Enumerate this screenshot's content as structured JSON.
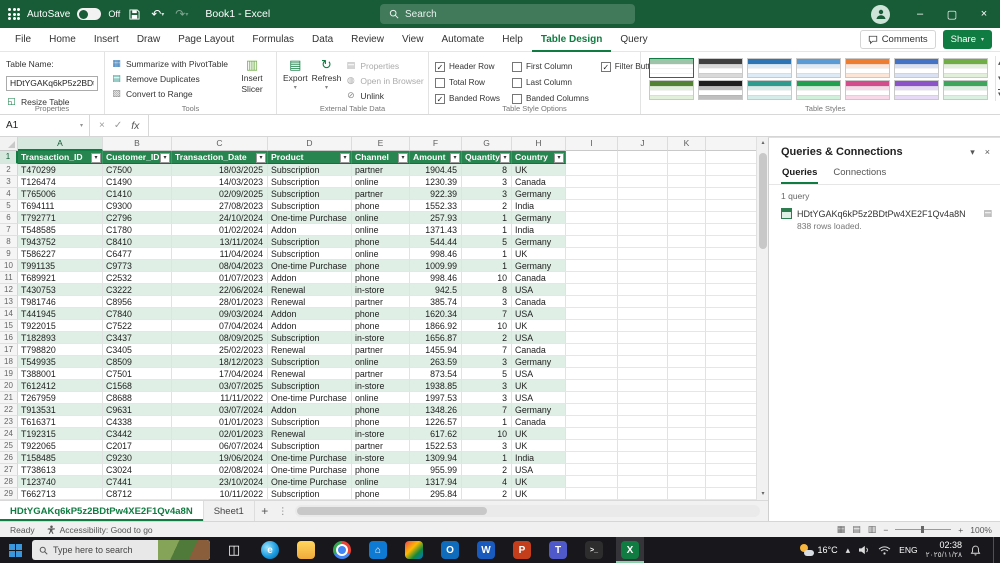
{
  "title_bar": {
    "autosave_label": "AutoSave",
    "autosave_state": "Off",
    "doc_title": "Book1 - Excel",
    "search_placeholder": "Search"
  },
  "ribbon": {
    "tabs": [
      "File",
      "Home",
      "Insert",
      "Draw",
      "Page Layout",
      "Formulas",
      "Data",
      "Review",
      "View",
      "Automate",
      "Help",
      "Table Design",
      "Query"
    ],
    "active_tab": "Table Design",
    "comments_label": "Comments",
    "share_label": "Share",
    "properties_group": {
      "group_label": "Properties",
      "table_name_label": "Table Name:",
      "table_name_value": "HDtYGAKq6kP5z2BDtPw4XE2F1Qv4a8N",
      "resize_table_label": "Resize Table"
    },
    "tools_group": {
      "group_label": "Tools",
      "summarize_label": "Summarize with PivotTable",
      "remove_duplicates_label": "Remove Duplicates",
      "convert_label": "Convert to Range",
      "insert_slicer_line1": "Insert",
      "insert_slicer_line2": "Slicer"
    },
    "external_group": {
      "group_label": "External Table Data",
      "export_label": "Export",
      "refresh_label": "Refresh",
      "properties_label": "Properties",
      "open_browser_label": "Open in Browser",
      "unlink_label": "Unlink"
    },
    "style_options": {
      "group_label": "Table Style Options",
      "options": [
        {
          "label": "Header Row",
          "checked": true
        },
        {
          "label": "Total Row",
          "checked": false
        },
        {
          "label": "Banded Rows",
          "checked": true
        },
        {
          "label": "First Column",
          "checked": false
        },
        {
          "label": "Last Column",
          "checked": false
        },
        {
          "label": "Banded Columns",
          "checked": false
        },
        {
          "label": "Filter Button",
          "checked": true
        }
      ]
    },
    "table_styles": {
      "group_label": "Table Styles",
      "swatches": [
        {
          "header": "#9DC3A8",
          "band": "#FFFFFF"
        },
        {
          "header": "#404040",
          "band": "#D9D9D9"
        },
        {
          "header": "#2E75B6",
          "band": "#DDEBF7"
        },
        {
          "header": "#5B9BD5",
          "band": "#DEEBF7"
        },
        {
          "header": "#ED7D31",
          "band": "#FCE4D6"
        },
        {
          "header": "#4472C4",
          "band": "#D9E1F2"
        },
        {
          "header": "#70AD47",
          "band": "#E2EFDA"
        },
        {
          "header": "#548235",
          "band": "#E2EFDA"
        },
        {
          "header": "#1F1F1F",
          "band": "#BFBFBF"
        },
        {
          "header": "#2E9B8F",
          "band": "#D6ECE9"
        },
        {
          "header": "#21A04F",
          "band": "#D1F0DC"
        },
        {
          "header": "#D34D8C",
          "band": "#F7D9E7"
        },
        {
          "header": "#8C52C7",
          "band": "#E7DAF6"
        },
        {
          "header": "#3FA45C",
          "band": "#DCF0E2"
        }
      ]
    }
  },
  "icons": {
    "pivot_table": "▦",
    "remove_duplicates": "▤",
    "convert_to_range": "▧",
    "insert_slicer": "▥",
    "export": "▤",
    "refresh": "↻",
    "properties": "▤",
    "open_in_browser": "◍",
    "unlink": "⊘",
    "resize_table": "◱",
    "filter_caret": "▾",
    "dropdown_caret": "▾",
    "undo": "↶",
    "redo": "↷",
    "minimize": "–",
    "maximize": "▢",
    "close": "×",
    "chevron_down": "▾",
    "chevron_up": "▴",
    "gallery_up": "▴",
    "gallery_down": "▾",
    "gallery_more": "▾",
    "view_normal": "▦",
    "view_layout": "▤",
    "view_break": "▥",
    "zoom_minus": "−",
    "zoom_plus": "+",
    "task_view": "◫",
    "tab_menu_dots": "⋮",
    "fx_label": "fx"
  },
  "formula_bar": {
    "name_box": "A1",
    "cancel_glyph": "×",
    "enter_glyph": "✓",
    "cell_value": ""
  },
  "grid": {
    "column_letters": [
      "A",
      "B",
      "C",
      "D",
      "E",
      "F",
      "G",
      "H",
      "I",
      "J",
      "K"
    ],
    "selected_cell": "A1",
    "selected_column": "A",
    "selected_row": "1"
  },
  "table": {
    "headers": [
      "Transaction_ID",
      "Customer_ID",
      "Transaction_Date",
      "Product",
      "Channel",
      "Amount",
      "Quantity",
      "Country"
    ],
    "rows": [
      [
        "T470299",
        "C7500",
        "18/03/2025",
        "Subscription",
        "partner",
        "1904.45",
        "8",
        "UK"
      ],
      [
        "T126474",
        "C1490",
        "14/03/2023",
        "Subscription",
        "online",
        "1230.39",
        "3",
        "Canada"
      ],
      [
        "T765006",
        "C1410",
        "02/09/2025",
        "Subscription",
        "partner",
        "922.39",
        "3",
        "Germany"
      ],
      [
        "T694111",
        "C9300",
        "27/08/2023",
        "Subscription",
        "phone",
        "1552.33",
        "2",
        "India"
      ],
      [
        "T792771",
        "C2796",
        "24/10/2024",
        "One-time Purchase",
        "online",
        "257.93",
        "1",
        "Germany"
      ],
      [
        "T548585",
        "C1780",
        "01/02/2024",
        "Addon",
        "online",
        "1371.43",
        "1",
        "India"
      ],
      [
        "T943752",
        "C8410",
        "13/11/2024",
        "Subscription",
        "phone",
        "544.44",
        "5",
        "Germany"
      ],
      [
        "T586227",
        "C6477",
        "11/04/2024",
        "Subscription",
        "online",
        "998.46",
        "1",
        "UK"
      ],
      [
        "T991135",
        "C9773",
        "08/04/2023",
        "One-time Purchase",
        "phone",
        "1009.99",
        "1",
        "Germany"
      ],
      [
        "T689921",
        "C2532",
        "01/07/2023",
        "Addon",
        "phone",
        "998.46",
        "10",
        "Canada"
      ],
      [
        "T430753",
        "C3222",
        "22/06/2024",
        "Renewal",
        "in-store",
        "942.5",
        "8",
        "USA"
      ],
      [
        "T981746",
        "C8956",
        "28/01/2023",
        "Renewal",
        "partner",
        "385.74",
        "3",
        "Canada"
      ],
      [
        "T441945",
        "C7840",
        "09/03/2024",
        "Addon",
        "phone",
        "1620.34",
        "7",
        "USA"
      ],
      [
        "T922015",
        "C7522",
        "07/04/2024",
        "Addon",
        "phone",
        "1866.92",
        "10",
        "UK"
      ],
      [
        "T182893",
        "C3437",
        "08/09/2025",
        "Subscription",
        "in-store",
        "1656.87",
        "2",
        "USA"
      ],
      [
        "T798820",
        "C3405",
        "25/02/2023",
        "Renewal",
        "partner",
        "1455.94",
        "7",
        "Canada"
      ],
      [
        "T549935",
        "C8509",
        "18/12/2023",
        "Subscription",
        "online",
        "263.59",
        "3",
        "Germany"
      ],
      [
        "T388001",
        "C7501",
        "17/04/2024",
        "Renewal",
        "partner",
        "873.54",
        "5",
        "USA"
      ],
      [
        "T612412",
        "C1568",
        "03/07/2025",
        "Subscription",
        "in-store",
        "1938.85",
        "3",
        "UK"
      ],
      [
        "T267959",
        "C8688",
        "11/11/2022",
        "One-time Purchase",
        "online",
        "1997.53",
        "3",
        "USA"
      ],
      [
        "T913531",
        "C9631",
        "03/07/2024",
        "Addon",
        "phone",
        "1348.26",
        "7",
        "Germany"
      ],
      [
        "T616371",
        "C4338",
        "01/01/2023",
        "Subscription",
        "phone",
        "1226.57",
        "1",
        "Canada"
      ],
      [
        "T192315",
        "C3442",
        "02/01/2023",
        "Renewal",
        "in-store",
        "617.62",
        "10",
        "UK"
      ],
      [
        "T922065",
        "C2017",
        "06/07/2024",
        "Subscription",
        "partner",
        "1522.53",
        "3",
        "UK"
      ],
      [
        "T158485",
        "C9230",
        "19/06/2024",
        "One-time Purchase",
        "in-store",
        "1309.94",
        "1",
        "India"
      ],
      [
        "T738613",
        "C3024",
        "02/08/2024",
        "One-time Purchase",
        "phone",
        "955.99",
        "2",
        "USA"
      ],
      [
        "T123740",
        "C7441",
        "23/10/2024",
        "One-time Purchase",
        "online",
        "1317.94",
        "4",
        "UK"
      ],
      [
        "T662713",
        "C8712",
        "10/11/2022",
        "Subscription",
        "phone",
        "295.84",
        "2",
        "UK"
      ]
    ]
  },
  "queries_panel": {
    "title": "Queries & Connections",
    "tabs": [
      "Queries",
      "Connections"
    ],
    "active_tab": "Queries",
    "count_label": "1 query",
    "query_name": "HDtYGAKq6kP5z2BDtPw4XE2F1Qv4a8N",
    "query_status": "838 rows loaded."
  },
  "sheet_bar": {
    "tabs": [
      "HDtYGAKq6kP5z2BDtPw4XE2F1Qv4a8N",
      "Sheet1"
    ],
    "active_tab": "HDtYGAKq6kP5z2BDtPw4XE2F1Qv4a8N",
    "add_sheet_label": "+"
  },
  "status_bar": {
    "ready_label": "Ready",
    "accessibility_label": "Accessibility: Good to go",
    "zoom_label": "100%"
  },
  "taskbar": {
    "search_placeholder": "Type here to search",
    "weather_temp": "16°C",
    "tray_language": "ENG",
    "tray_time": "02:38",
    "tray_date": "٢٠٢٥/١١/٢٨",
    "icons": [
      {
        "name": "task-view",
        "glyph": "◫"
      },
      {
        "name": "edge",
        "glyph": "e"
      },
      {
        "name": "file-explorer",
        "glyph": ""
      },
      {
        "name": "chrome",
        "glyph": ""
      },
      {
        "name": "store",
        "glyph": "⌂"
      },
      {
        "name": "photos",
        "glyph": ""
      },
      {
        "name": "outlook",
        "glyph": "O"
      },
      {
        "name": "word",
        "glyph": "W"
      },
      {
        "name": "powerpoint",
        "glyph": "P"
      },
      {
        "name": "teams",
        "glyph": "T"
      },
      {
        "name": "terminal",
        "glyph": "&gt;_"
      },
      {
        "name": "excel",
        "glyph": "X",
        "active": true
      }
    ]
  },
  "colors": {
    "accent_green": "#107C41",
    "title_bar_green": "#185C37",
    "table_header_green": "#278650",
    "banded_row_green": "#DFEFE5"
  }
}
